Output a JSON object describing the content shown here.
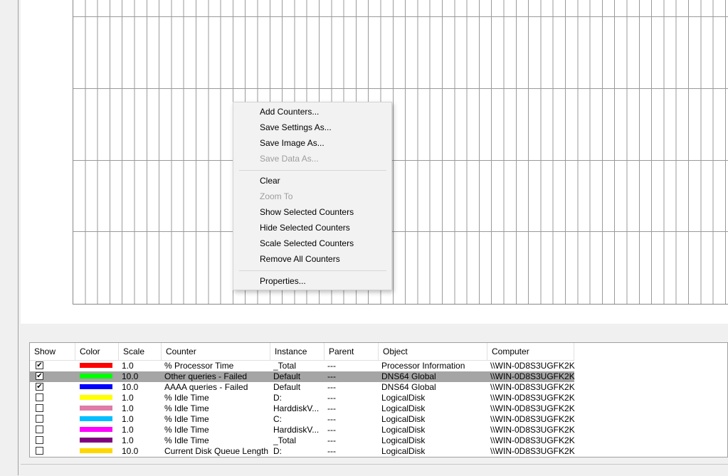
{
  "context_menu": {
    "items": [
      {
        "label": "Add Counters...",
        "enabled": true
      },
      {
        "label": "Save Settings As...",
        "enabled": true
      },
      {
        "label": "Save Image As...",
        "enabled": true
      },
      {
        "label": "Save Data As...",
        "enabled": false
      },
      {
        "label": "Clear",
        "enabled": true
      },
      {
        "label": "Zoom To",
        "enabled": false
      },
      {
        "label": "Show Selected Counters",
        "enabled": true
      },
      {
        "label": "Hide Selected Counters",
        "enabled": true
      },
      {
        "label": "Scale Selected Counters",
        "enabled": true
      },
      {
        "label": "Remove All Counters",
        "enabled": true
      },
      {
        "label": "Properties...",
        "enabled": true
      }
    ]
  },
  "legend": {
    "columns": [
      "Show",
      "Color",
      "Scale",
      "Counter",
      "Instance",
      "Parent",
      "Object",
      "Computer"
    ],
    "rows": [
      {
        "show": true,
        "color": "#ff0000",
        "scale": "1.0",
        "counter": "% Processor Time",
        "instance": "_Total",
        "parent": "---",
        "object": "Processor Information",
        "computer": "\\\\WIN-0D8S3UGFK2K",
        "selected": false
      },
      {
        "show": true,
        "color": "#00ff00",
        "scale": "10.0",
        "counter": "Other queries - Failed",
        "instance": "Default",
        "parent": "---",
        "object": "DNS64 Global",
        "computer": "\\\\WIN-0D8S3UGFK2K",
        "selected": true
      },
      {
        "show": true,
        "color": "#0000ff",
        "scale": "10.0",
        "counter": "AAAA queries - Failed",
        "instance": "Default",
        "parent": "---",
        "object": "DNS64 Global",
        "computer": "\\\\WIN-0D8S3UGFK2K",
        "selected": false
      },
      {
        "show": false,
        "color": "#ffff00",
        "scale": "1.0",
        "counter": "% Idle Time",
        "instance": "D:",
        "parent": "---",
        "object": "LogicalDisk",
        "computer": "\\\\WIN-0D8S3UGFK2K",
        "selected": false
      },
      {
        "show": false,
        "color": "#e07aa8",
        "scale": "1.0",
        "counter": "% Idle Time",
        "instance": "HarddiskV...",
        "parent": "---",
        "object": "LogicalDisk",
        "computer": "\\\\WIN-0D8S3UGFK2K",
        "selected": false
      },
      {
        "show": false,
        "color": "#00bfff",
        "scale": "1.0",
        "counter": "% Idle Time",
        "instance": "C:",
        "parent": "---",
        "object": "LogicalDisk",
        "computer": "\\\\WIN-0D8S3UGFK2K",
        "selected": false
      },
      {
        "show": false,
        "color": "#ff00ff",
        "scale": "1.0",
        "counter": "% Idle Time",
        "instance": "HarddiskV...",
        "parent": "---",
        "object": "LogicalDisk",
        "computer": "\\\\WIN-0D8S3UGFK2K",
        "selected": false
      },
      {
        "show": false,
        "color": "#800080",
        "scale": "1.0",
        "counter": "% Idle Time",
        "instance": "_Total",
        "parent": "---",
        "object": "LogicalDisk",
        "computer": "\\\\WIN-0D8S3UGFK2K",
        "selected": false
      },
      {
        "show": false,
        "color": "#ffd700",
        "scale": "10.0",
        "counter": "Current Disk Queue Length",
        "instance": "D:",
        "parent": "---",
        "object": "LogicalDisk",
        "computer": "\\\\WIN-0D8S3UGFK2K",
        "selected": false
      }
    ]
  }
}
